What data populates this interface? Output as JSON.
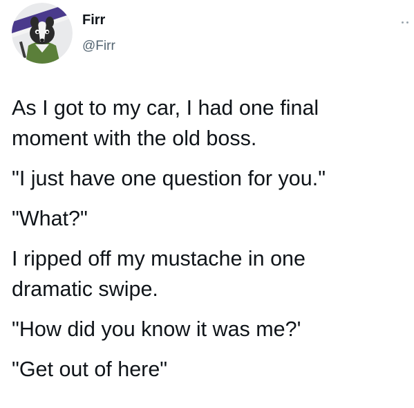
{
  "tweet": {
    "author": {
      "display_name": "Firr",
      "handle": "@Firr",
      "avatar_icon": "skunk-character-avatar"
    },
    "more_icon": "more-options-icon",
    "paragraphs": [
      "As I got to my car, I had one final\nmoment with the old boss.",
      "\"I just have one question for you.\"",
      "\"What?\"",
      "I ripped off my mustache in one\ndramatic swipe.",
      "\"How did you know it was me?'",
      "\"Get out of here\""
    ]
  },
  "colors": {
    "text_primary": "#0f1419",
    "text_secondary": "#536471",
    "avatar_background": "#e9eaec",
    "avatar_stripe_purple": "#4a3a8c",
    "avatar_fur_green": "#5b7f3a"
  }
}
